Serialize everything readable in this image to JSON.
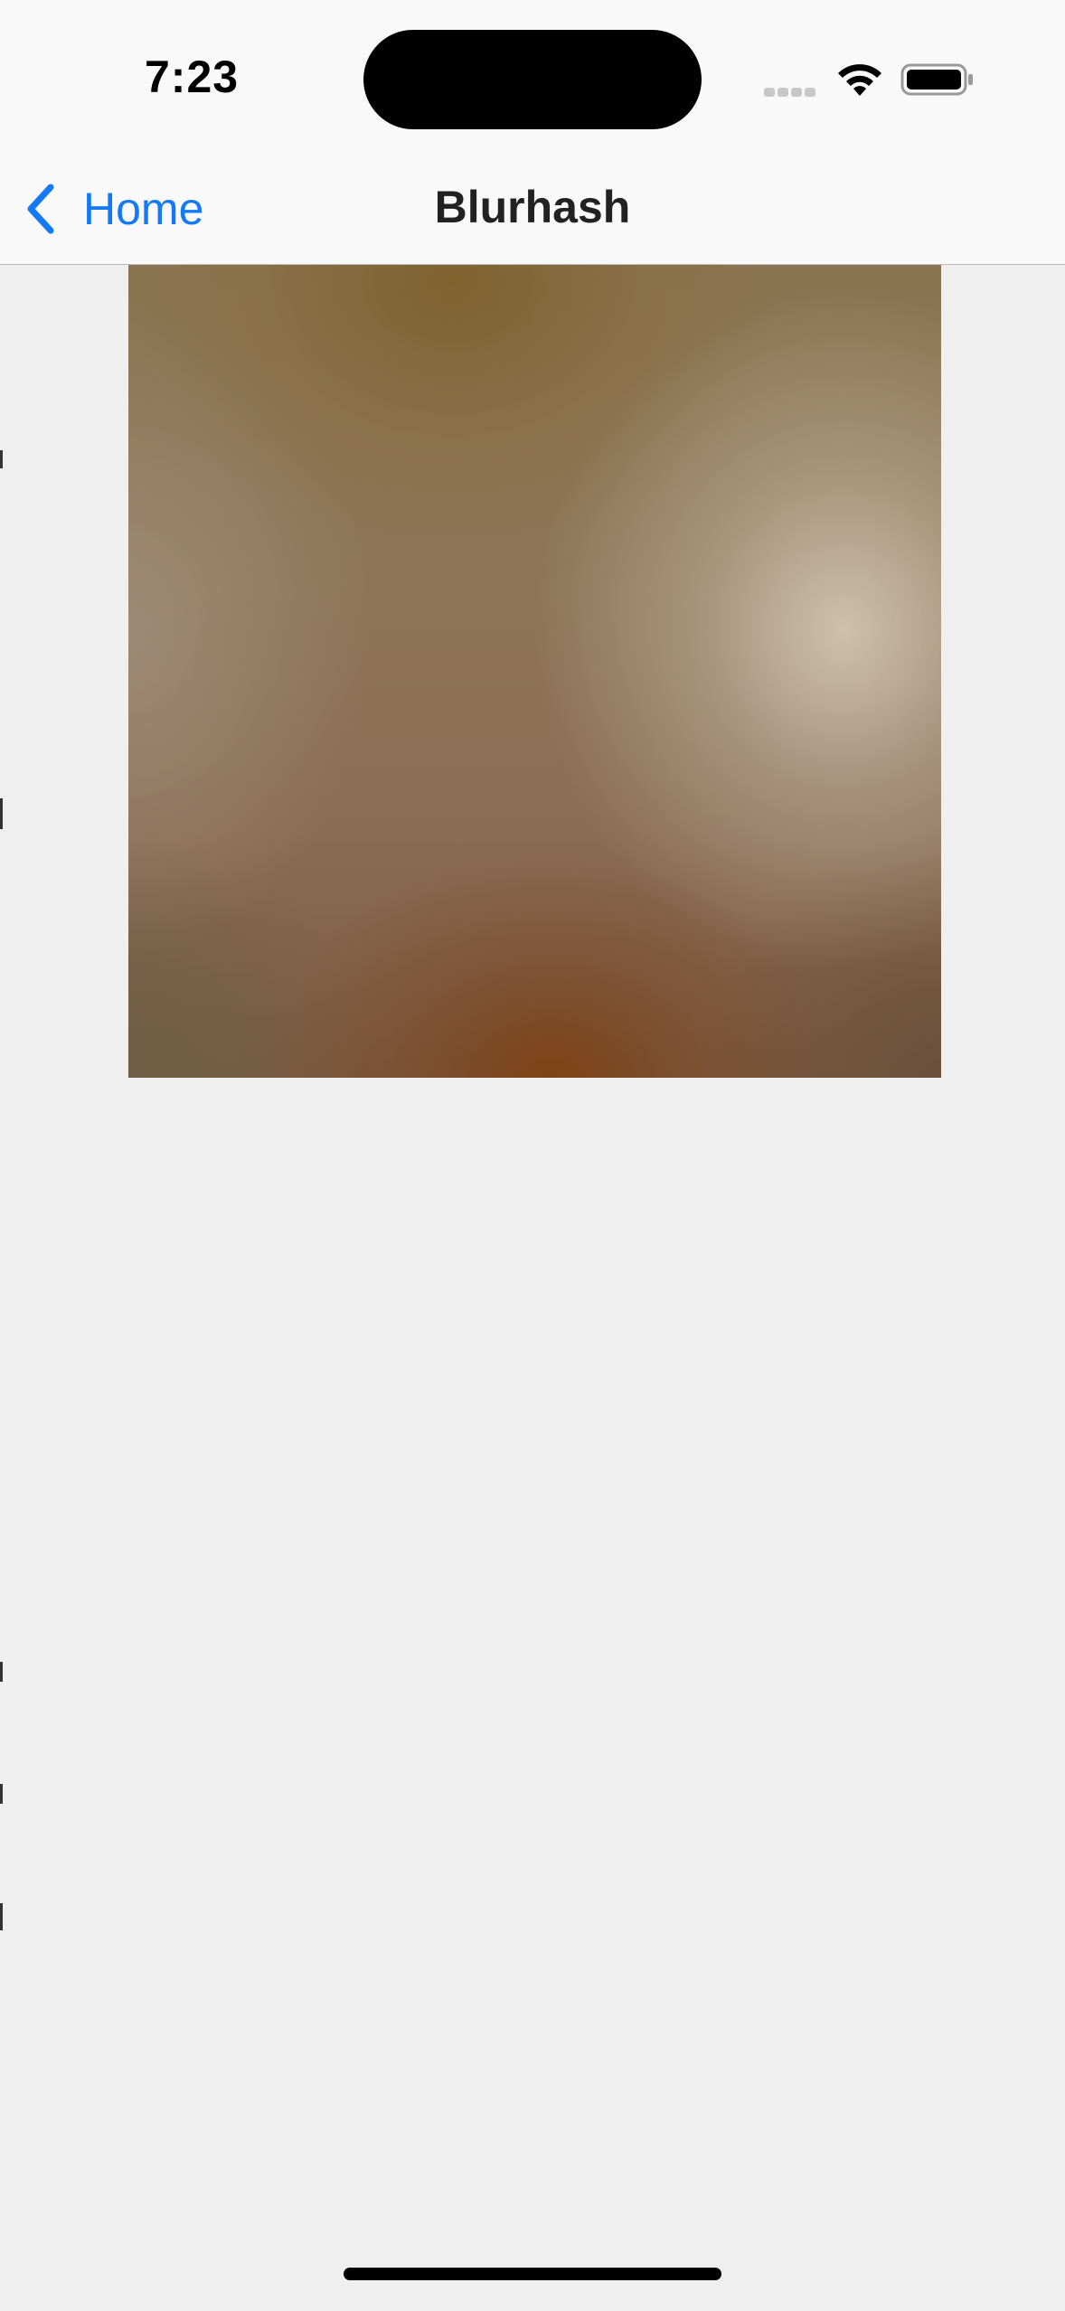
{
  "status_bar": {
    "time": "7:23",
    "icons": [
      "cellular-signal-icon",
      "wifi-icon",
      "battery-icon"
    ]
  },
  "nav": {
    "back_label": "Home",
    "back_icon": "chevron-left-icon",
    "title": "Blurhash"
  },
  "colors": {
    "accent": "#1479f5",
    "background": "#efefef",
    "bar_background": "#f9f9f9"
  },
  "content": {
    "image": "blurhash-placeholder-image"
  }
}
